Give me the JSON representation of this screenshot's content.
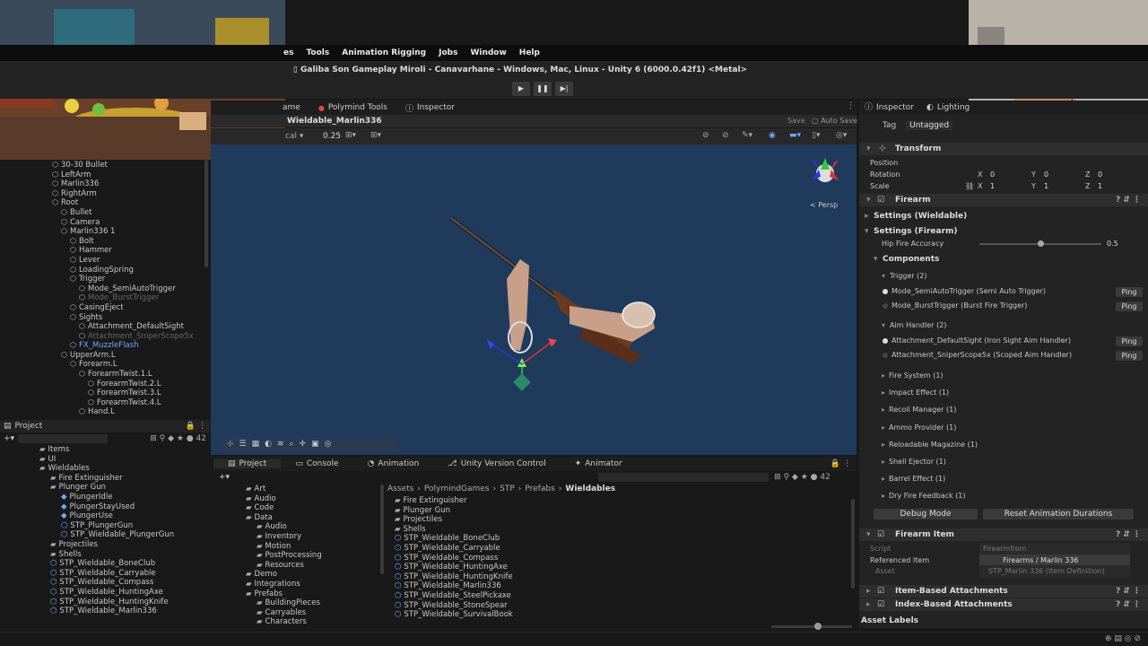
{
  "menu": [
    "es",
    "Tools",
    "Animation Rigging",
    "Jobs",
    "Window",
    "Help"
  ],
  "window_title": "Galiba Son Gameplay Miroli - Canavarhane - Windows, Mac, Linux - Unity 6 (6000.0.42f1) <Metal>",
  "play": {
    "play": "▶",
    "pause": "❚❚",
    "step": "▶|"
  },
  "top_tabs": {
    "game": "ame",
    "polymind": "Polymind Tools",
    "inspector": "Inspector"
  },
  "scene": {
    "title": "Wieldable_Marlin336",
    "save": "Save",
    "auto_save": "Auto Save",
    "zoom": "0.25",
    "view_label": "cal",
    "persp": "< Persp"
  },
  "hierarchy": [
    {
      "n": "30-30 Bullet",
      "d": 3
    },
    {
      "n": "LeftArm",
      "d": 3
    },
    {
      "n": "Marlin336",
      "d": 3
    },
    {
      "n": "RightArm",
      "d": 3
    },
    {
      "n": "Root",
      "d": 3
    },
    {
      "n": "Bullet",
      "d": 4
    },
    {
      "n": "Camera",
      "d": 4
    },
    {
      "n": "Marlin336 1",
      "d": 4
    },
    {
      "n": "Bolt",
      "d": 5
    },
    {
      "n": "Hammer",
      "d": 5
    },
    {
      "n": "Lever",
      "d": 5
    },
    {
      "n": "LoadingSpring",
      "d": 5
    },
    {
      "n": "Trigger",
      "d": 5
    },
    {
      "n": "Mode_SemiAutoTrigger",
      "d": 6
    },
    {
      "n": "Mode_BurstTrigger",
      "d": 6,
      "dim": true
    },
    {
      "n": "CasingEject",
      "d": 5
    },
    {
      "n": "Sights",
      "d": 5
    },
    {
      "n": "Attachment_DefaultSight",
      "d": 6
    },
    {
      "n": "Attachment_SniperScope5x",
      "d": 6,
      "dim": true
    },
    {
      "n": "FX_MuzzleFlash",
      "d": 5,
      "blue": true
    },
    {
      "n": "UpperArm.L",
      "d": 4
    },
    {
      "n": "Forearm.L",
      "d": 5
    },
    {
      "n": "ForearmTwist.1.L",
      "d": 6
    },
    {
      "n": "ForearmTwist.2.L",
      "d": 7
    },
    {
      "n": "ForearmTwist.3.L",
      "d": 7
    },
    {
      "n": "ForearmTwist.4.L",
      "d": 7
    },
    {
      "n": "Hand.L",
      "d": 6
    }
  ],
  "project_left": {
    "title": "Project",
    "count": "42",
    "items": [
      {
        "n": "Items",
        "d": 2,
        "t": "f"
      },
      {
        "n": "UI",
        "d": 2,
        "t": "f"
      },
      {
        "n": "Wieldables",
        "d": 2,
        "t": "f"
      },
      {
        "n": "Fire Extinguisher",
        "d": 3,
        "t": "f"
      },
      {
        "n": "Plunger Gun",
        "d": 3,
        "t": "f"
      },
      {
        "n": "PlungerIdle",
        "d": 4,
        "t": "a"
      },
      {
        "n": "PlungerStayUsed",
        "d": 4,
        "t": "a"
      },
      {
        "n": "PlungerUse",
        "d": 4,
        "t": "a"
      },
      {
        "n": "STP_PlungerGun",
        "d": 4,
        "t": "p"
      },
      {
        "n": "STP_Wieldable_PlungerGun",
        "d": 4,
        "t": "p"
      },
      {
        "n": "Projectiles",
        "d": 3,
        "t": "f"
      },
      {
        "n": "Shells",
        "d": 3,
        "t": "f"
      },
      {
        "n": "STP_Wieldable_BoneClub",
        "d": 3,
        "t": "p"
      },
      {
        "n": "STP_Wieldable_Carryable",
        "d": 3,
        "t": "p"
      },
      {
        "n": "STP_Wieldable_Compass",
        "d": 3,
        "t": "p"
      },
      {
        "n": "STP_Wieldable_HuntingAxe",
        "d": 3,
        "t": "p"
      },
      {
        "n": "STP_Wieldable_HuntingKnife",
        "d": 3,
        "t": "p"
      },
      {
        "n": "STP_Wieldable_Marlin336",
        "d": 3,
        "t": "p"
      }
    ]
  },
  "bottom_tabs": [
    "Project",
    "Console",
    "Animation",
    "Unity Version Control",
    "Animator"
  ],
  "bottom_count": "42",
  "folder_tree": [
    {
      "n": "Art",
      "d": 1
    },
    {
      "n": "Audio",
      "d": 1
    },
    {
      "n": "Code",
      "d": 1
    },
    {
      "n": "Data",
      "d": 1
    },
    {
      "n": "Audio",
      "d": 2
    },
    {
      "n": "Inventory",
      "d": 2
    },
    {
      "n": "Motion",
      "d": 2
    },
    {
      "n": "PostProcessing",
      "d": 2
    },
    {
      "n": "Resources",
      "d": 2
    },
    {
      "n": "Demo",
      "d": 1
    },
    {
      "n": "Integrations",
      "d": 1
    },
    {
      "n": "Prefabs",
      "d": 1
    },
    {
      "n": "BuildingPieces",
      "d": 2
    },
    {
      "n": "Carryables",
      "d": 2
    },
    {
      "n": "Characters",
      "d": 2
    }
  ],
  "breadcrumb": [
    "Assets",
    "PolymindGames",
    "STP",
    "Prefabs",
    "Wieldables"
  ],
  "assets": [
    {
      "n": "Fire Extinguisher",
      "t": "f"
    },
    {
      "n": "Plunger Gun",
      "t": "f"
    },
    {
      "n": "Projectiles",
      "t": "f"
    },
    {
      "n": "Shells",
      "t": "f"
    },
    {
      "n": "STP_Wieldable_BoneClub",
      "t": "p"
    },
    {
      "n": "STP_Wieldable_Carryable",
      "t": "p"
    },
    {
      "n": "STP_Wieldable_Compass",
      "t": "p"
    },
    {
      "n": "STP_Wieldable_HuntingAxe",
      "t": "p"
    },
    {
      "n": "STP_Wieldable_HuntingKnife",
      "t": "p"
    },
    {
      "n": "STP_Wieldable_Marlin336",
      "t": "p"
    },
    {
      "n": "STP_Wieldable_SteelPickaxe",
      "t": "p"
    },
    {
      "n": "STP_Wieldable_StoneSpear",
      "t": "p"
    },
    {
      "n": "STP_Wieldable_SurvivalBook",
      "t": "p"
    }
  ],
  "inspector": {
    "tabs": {
      "inspector": "Inspector",
      "lighting": "Lighting"
    },
    "tag_label": "Tag",
    "tag_value": "Untagged",
    "transform": "Transform",
    "position": "Position",
    "rotation": "Rotation",
    "scale": "Scale",
    "rot": {
      "x": "0",
      "y": "0",
      "z": "0"
    },
    "scl": {
      "x": "1",
      "y": "1",
      "z": "1"
    },
    "x": "X",
    "y": "Y",
    "z": "Z",
    "firearm": "Firearm",
    "settings_wieldable": "Settings (Wieldable)",
    "settings_firearm": "Settings (Firearm)",
    "hip_fire": "Hip Fire Accuracy",
    "hip_value": "0.5",
    "hip_fraction": 0.5,
    "components": "Components",
    "trigger": "Trigger (2)",
    "trig1": "Mode_SemiAutoTrigger (Semi Auto Trigger)",
    "trig2": "Mode_BurstTrigger (Burst Fire Trigger)",
    "aim": "Aim Handler (2)",
    "aim1": "Attachment_DefaultSight (Iron Sight Aim Handler)",
    "aim2": "Attachment_SniperScope5x (Scoped Aim Handler)",
    "ping": "Ping",
    "collapsed": [
      "Fire System (1)",
      "Impact Effect (1)",
      "Recoil Manager (1)",
      "Ammo Provider (1)",
      "Reloadable Magazine (1)",
      "Shell Ejector (1)",
      "Barrel Effect (1)",
      "Dry Fire Feedback (1)"
    ],
    "debug_mode": "Debug Mode",
    "reset_anim": "Reset Animation Durations",
    "firearm_item": "Firearm Item",
    "script_label": "Script",
    "script_value": "FirearmItem",
    "ref_label": "Referenced Item",
    "ref_value": "Firearms / Marlin 336",
    "asset_label": "Asset",
    "asset_value": "STP_Marlin 336 (Item Definition)",
    "item_attach": "Item-Based Attachments",
    "index_attach": "Index-Based Attachments",
    "asset_labels": "Asset Labels"
  }
}
